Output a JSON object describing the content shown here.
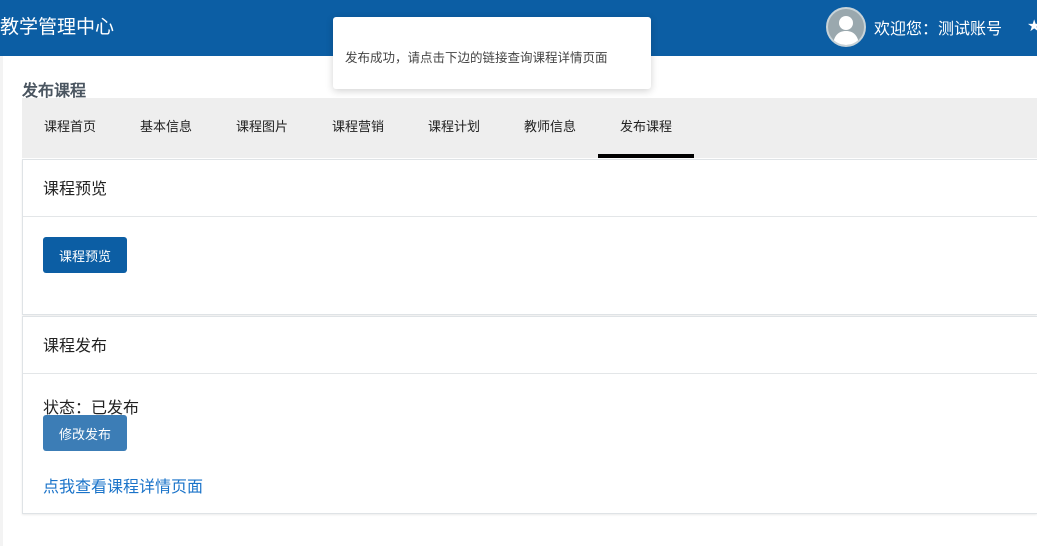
{
  "header": {
    "app_title": "教学管理中心",
    "welcome_text": "欢迎您：测试账号",
    "avatar_icon": "user-avatar-icon",
    "star_icon": "star-icon",
    "background_color": "#0c5ea4"
  },
  "page": {
    "heading": "发布课程"
  },
  "tabs": [
    {
      "label": "课程首页",
      "active": false
    },
    {
      "label": "基本信息",
      "active": false
    },
    {
      "label": "课程图片",
      "active": false
    },
    {
      "label": "课程营销",
      "active": false
    },
    {
      "label": "课程计划",
      "active": false
    },
    {
      "label": "教师信息",
      "active": false
    },
    {
      "label": "发布课程",
      "active": true
    }
  ],
  "preview_panel": {
    "title": "课程预览",
    "button_label": "课程预览"
  },
  "publish_panel": {
    "title": "课程发布",
    "status_text": "状态：已发布",
    "button_label": "修改发布",
    "link_text": "点我查看课程详情页面"
  },
  "toast": {
    "message": "发布成功，请点击下边的链接查询课程详情页面"
  }
}
